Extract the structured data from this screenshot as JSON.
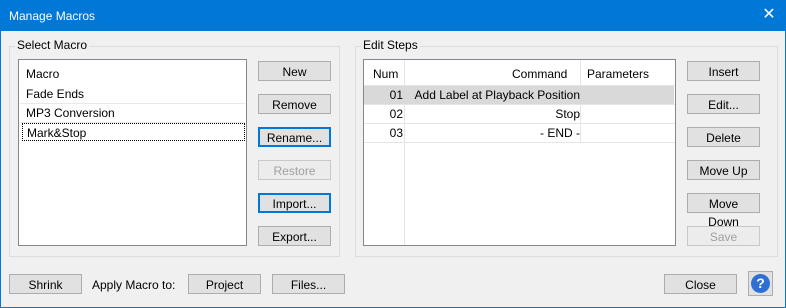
{
  "window": {
    "title": "Manage Macros",
    "close_glyph": "✕"
  },
  "select_macro": {
    "label": "Select Macro",
    "header": "Macro",
    "items": [
      "Fade Ends",
      "MP3 Conversion",
      "Mark&Stop"
    ],
    "selected": "Mark&Stop"
  },
  "macro_buttons": {
    "new": "New",
    "remove": "Remove",
    "rename": "Rename...",
    "restore": "Restore",
    "import": "Import...",
    "export": "Export..."
  },
  "edit_steps": {
    "label": "Edit Steps",
    "columns": {
      "num": "Num",
      "command": "Command",
      "parameters": "Parameters"
    },
    "rows": [
      {
        "num": "01",
        "command": "Add Label at Playback Position",
        "parameters": ""
      },
      {
        "num": "02",
        "command": "Stop",
        "parameters": ""
      },
      {
        "num": "03",
        "command": "- END -",
        "parameters": ""
      }
    ],
    "selected_row": "01"
  },
  "step_buttons": {
    "insert": "Insert",
    "edit": "Edit...",
    "delete": "Delete",
    "move_up": "Move Up",
    "move_down": "Move Down",
    "save": "Save"
  },
  "footer": {
    "shrink": "Shrink",
    "apply_label": "Apply Macro to:",
    "project": "Project",
    "files": "Files...",
    "close": "Close",
    "help_glyph": "?"
  },
  "colors": {
    "accent": "#0078d7",
    "help_blue": "#2e6fd6",
    "selected_row": "#d9d9d9"
  }
}
